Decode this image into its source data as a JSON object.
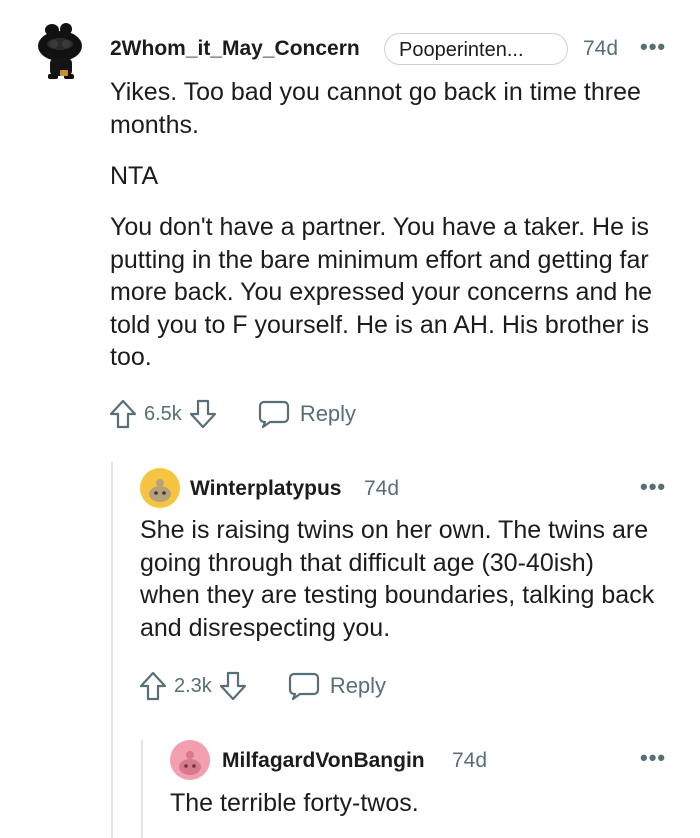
{
  "comments": [
    {
      "username": "2Whom_it_May_Concern",
      "flair": "Pooperinten...",
      "age": "74d",
      "more": "•••",
      "paragraphs": [
        "Yikes. Too bad you cannot go back in time three months.",
        "NTA",
        "You don't have a partner. You have a taker. He is putting in the bare minimum effort and getting far more back. You expressed your concerns and he told you to F yourself. He is an AH. His brother is too."
      ],
      "votes": "6.5k",
      "reply_label": "Reply"
    },
    {
      "username": "Winterplatypus",
      "age": "74d",
      "more": "•••",
      "paragraphs": [
        "She is raising twins on her own. The twins are going through that difficult age (30-40ish) when they are testing boundaries, talking back and disrespecting you."
      ],
      "votes": "2.3k",
      "reply_label": "Reply"
    },
    {
      "username": "MilfagardVonBangin",
      "age": "74d",
      "more": "•••",
      "paragraphs": [
        "The terrible forty-twos."
      ]
    }
  ],
  "colors": {
    "text": "#1c1c1c",
    "meta": "#576f76",
    "thread_line": "#e1e4e6",
    "avatar2_bg": "#f5c542",
    "avatar3_bg": "#f29fb0"
  },
  "icons": [
    "snoo-avatar-icon",
    "upvote-icon",
    "downvote-icon",
    "reply-bubble-icon",
    "more-options-icon"
  ]
}
